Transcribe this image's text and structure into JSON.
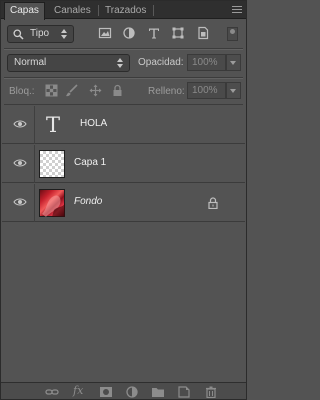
{
  "tabs": [
    {
      "label": "Capas",
      "active": true
    },
    {
      "label": "Canales",
      "active": false
    },
    {
      "label": "Trazados",
      "active": false
    }
  ],
  "filter": {
    "kind_label": "Tipo"
  },
  "blend": {
    "mode": "Normal",
    "opacity_label": "Opacidad:",
    "opacity_value": "100%"
  },
  "lock": {
    "label": "Bloq.:",
    "fill_label": "Relleno:",
    "fill_value": "100%"
  },
  "layers": [
    {
      "name": "HOLA",
      "type": "text",
      "thumb_glyph": "T"
    },
    {
      "name": "Capa 1",
      "type": "transparent"
    },
    {
      "name": "Fondo",
      "type": "image",
      "locked": true
    }
  ],
  "bottom": {
    "fx_label": "fx"
  },
  "colors": {
    "panel_bg": "#535353",
    "tab_bg": "#2f2f2f",
    "text": "#d6d6d6"
  }
}
